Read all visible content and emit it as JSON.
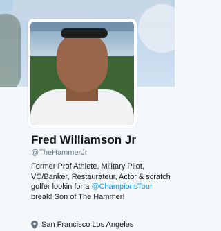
{
  "profile": {
    "name": "Fred Williamson Jr",
    "handle": "@TheHammerJr",
    "bio": {
      "part1": "Former Prof Athlete, Military Pilot, VC/Banker, Restaurateur, Actor & scratch golfer lookin for a ",
      "hashtag": "@ChampionsTour",
      "part2": " break! Son of The Hammer!"
    },
    "location": "San Francisco Los Angeles",
    "location_icon": "map-pin-icon"
  },
  "colors": {
    "link": "#1b95e0",
    "name": "#14171a",
    "muted": "#657786",
    "background": "#f5f8fa"
  }
}
